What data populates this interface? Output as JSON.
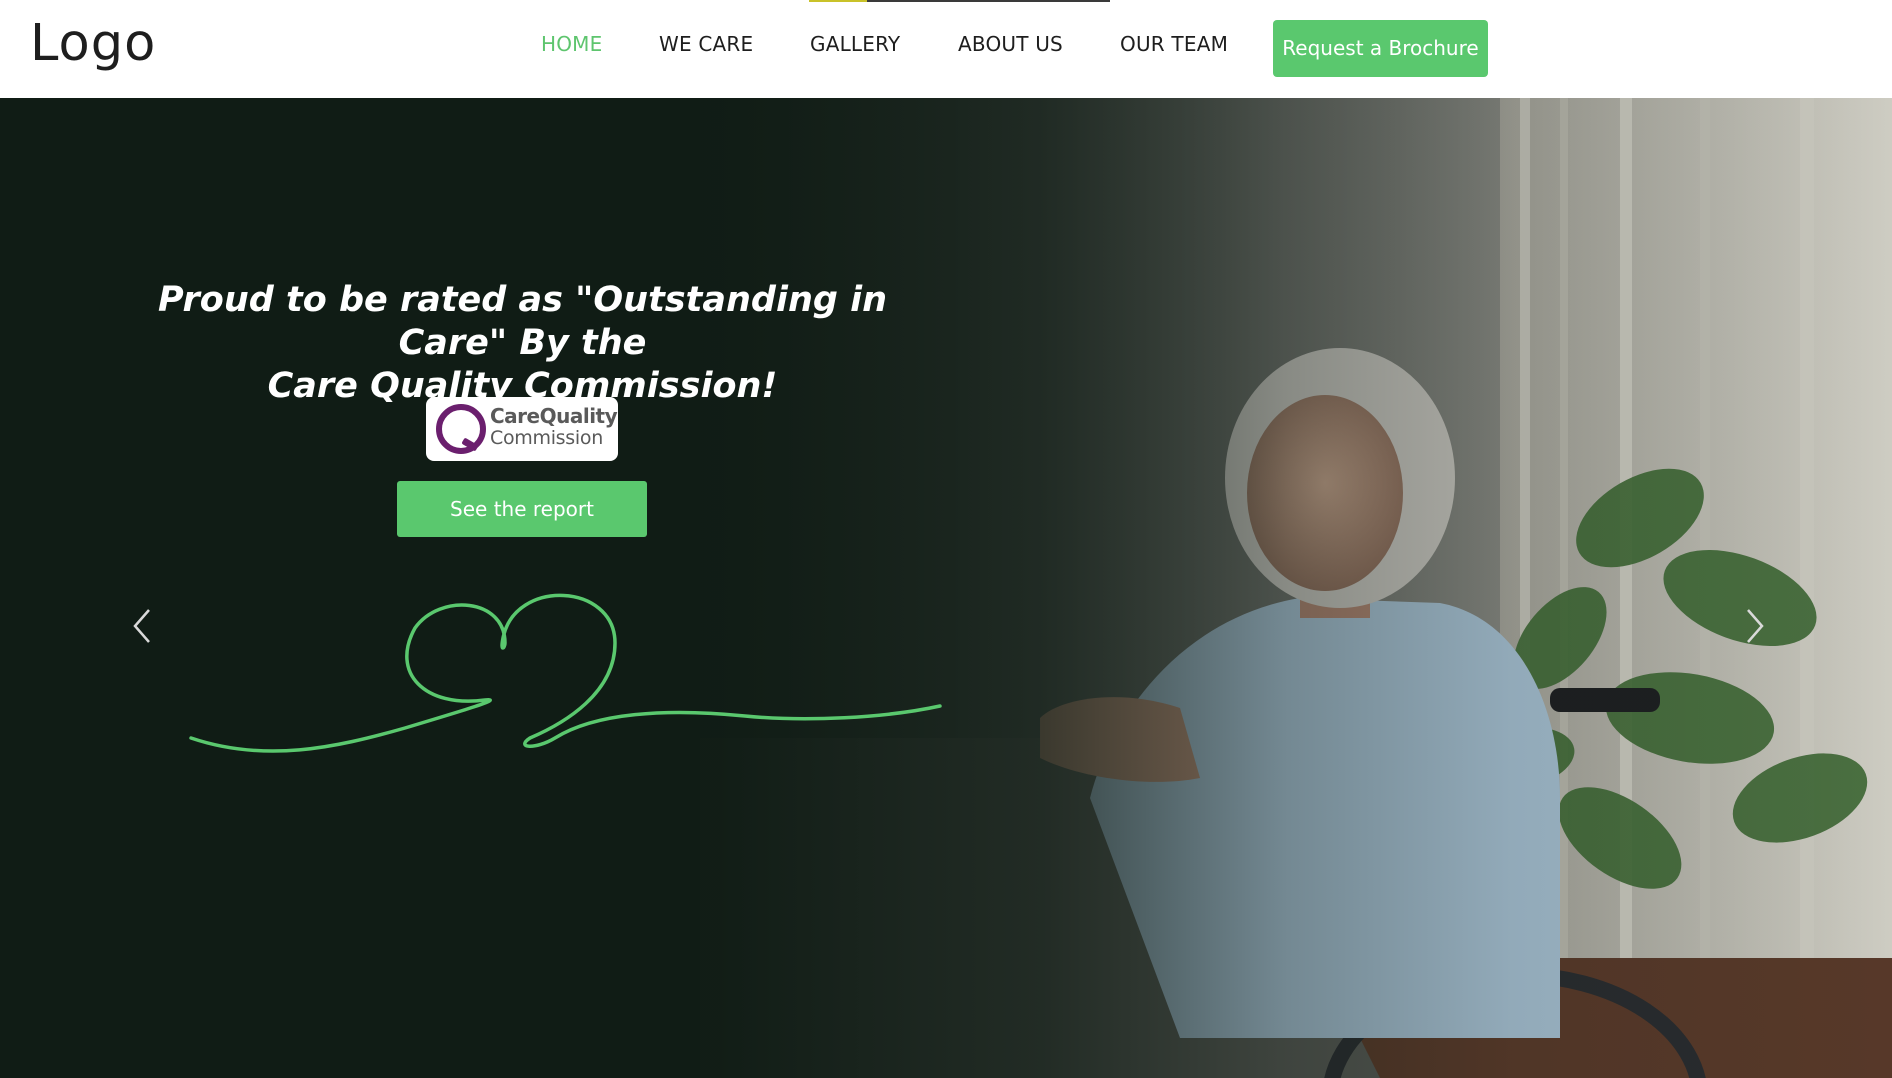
{
  "header": {
    "logo_text": "Logo",
    "nav": [
      {
        "label": "HOME",
        "active": true
      },
      {
        "label": "WE CARE",
        "active": false
      },
      {
        "label": "GALLERY",
        "active": false
      },
      {
        "label": "ABOUT US",
        "active": false
      },
      {
        "label": "OUR TEAM",
        "active": false
      }
    ],
    "cta_label": "Request a Brochure"
  },
  "hero": {
    "headline_part1": "Proud to be rated as \"Outstanding in Care\" By the",
    "headline_part2": "Care Quality Commission!",
    "badge": {
      "line1": "CareQuality",
      "line2": "Commission"
    },
    "button_label": "See the report",
    "prev_icon": "chevron-left-icon",
    "next_icon": "chevron-right-icon"
  },
  "colors": {
    "accent": "#5ac86e",
    "active_nav": "#5ec56e",
    "hero_dark": "#101c15",
    "cqc_purple": "#6b1f6e"
  }
}
